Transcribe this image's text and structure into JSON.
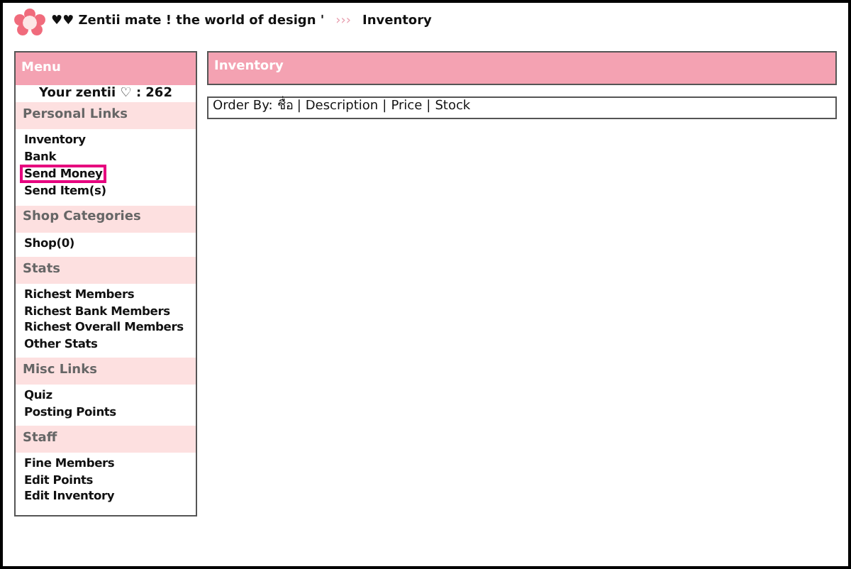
{
  "header": {
    "site_title": "♥♥ Zentii mate ! the world of design '",
    "separator": "›››",
    "current_page": "Inventory"
  },
  "sidebar": {
    "title": "Menu",
    "balance": "Your zentii ♡ : 262",
    "sections": [
      {
        "title": "Personal Links",
        "links": [
          {
            "label": "Inventory",
            "highlighted": false
          },
          {
            "label": "Bank",
            "highlighted": false
          },
          {
            "label": "Send Money",
            "highlighted": true
          },
          {
            "label": "Send Item(s)",
            "highlighted": false
          }
        ]
      },
      {
        "title": "Shop Categories",
        "links": [
          {
            "label": "Shop(0)",
            "highlighted": false
          }
        ]
      },
      {
        "title": "Stats",
        "links": [
          {
            "label": "Richest Members",
            "highlighted": false
          },
          {
            "label": "Richest Bank Members",
            "highlighted": false
          },
          {
            "label": "Richest Overall Members",
            "highlighted": false
          },
          {
            "label": "Other Stats",
            "highlighted": false
          }
        ]
      },
      {
        "title": "Misc Links",
        "links": [
          {
            "label": "Quiz",
            "highlighted": false
          },
          {
            "label": "Posting Points",
            "highlighted": false
          }
        ]
      },
      {
        "title": "Staff",
        "links": [
          {
            "label": "Fine Members",
            "highlighted": false
          },
          {
            "label": "Edit Points",
            "highlighted": false
          },
          {
            "label": "Edit Inventory",
            "highlighted": false
          }
        ]
      }
    ]
  },
  "main": {
    "title": "Inventory",
    "order_by": {
      "label": "Order By:",
      "separator": "|",
      "options": [
        "ชื่อ",
        "Description",
        "Price",
        "Stock"
      ]
    }
  }
}
